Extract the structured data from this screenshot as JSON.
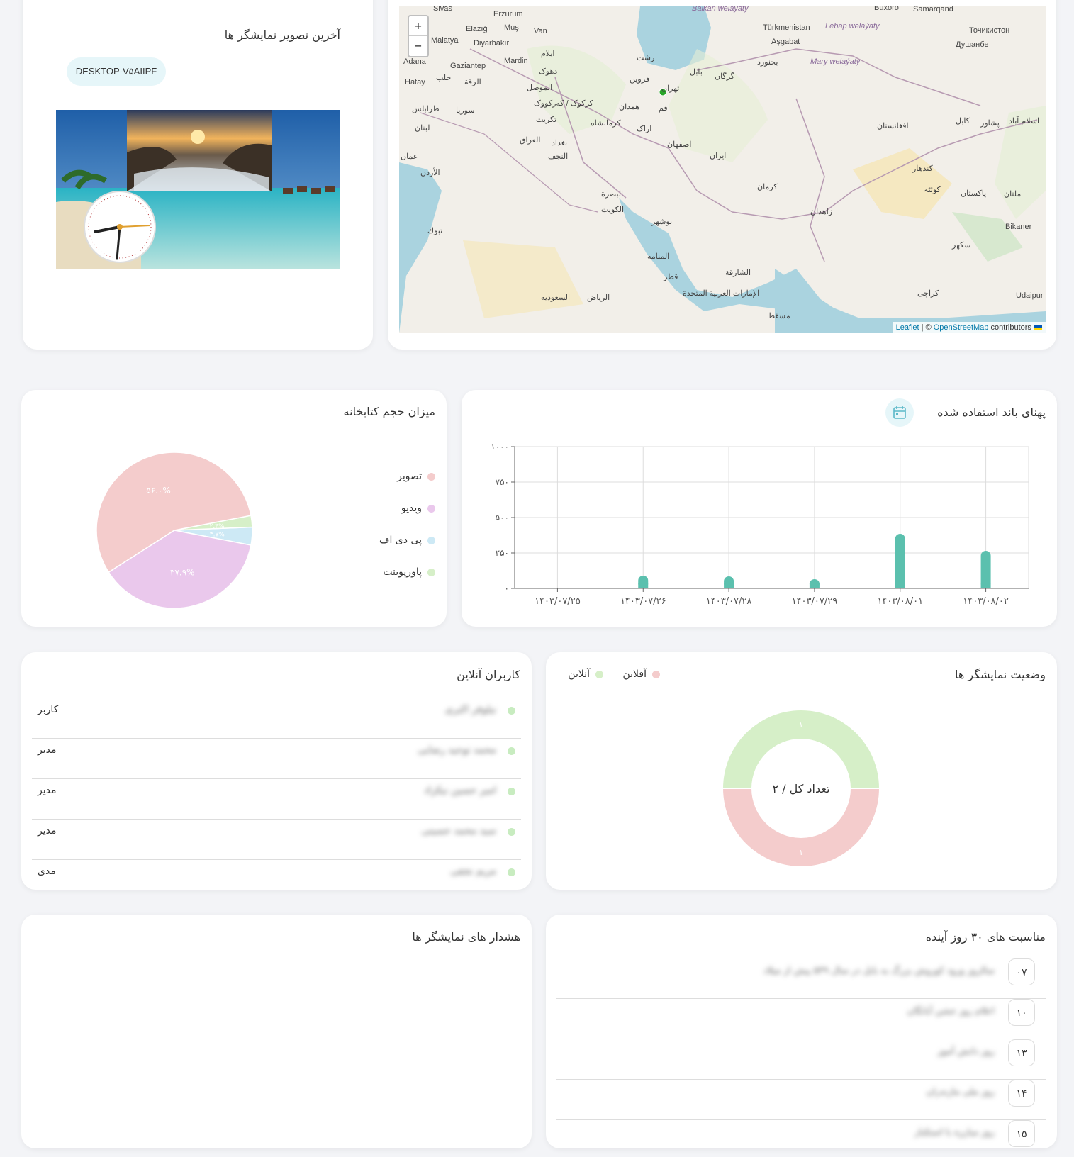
{
  "preview": {
    "title": "آخرین تصویر نمایشگر ها",
    "device_name": "DESKTOP-V۵AIIPF"
  },
  "map": {
    "zoom_in": "+",
    "zoom_out": "−",
    "attribution_leaflet": "Leaflet",
    "attribution_sep": " | © ",
    "attribution_osm": "OpenStreetMap",
    "attribution_tail": " contributors",
    "labels": [
      "Sivas",
      "Erzurum",
      "Elazığ",
      "Muş",
      "Van",
      "Malatya",
      "Diyarbakır",
      "Adana",
      "Gaziantep",
      "Mardin",
      "Hatay",
      "حلب",
      "الرقة",
      "دهوک",
      "الموصل",
      "کرکوک / که‌رکووک",
      "تکریت",
      "العراق",
      "بغداد",
      "النجف",
      "کرمانشاه",
      "همدان",
      "قزوین",
      "رشت",
      "بابل",
      "گرگان",
      "تهران",
      "قم",
      "اراک",
      "اصفهان",
      "ایران",
      "کرمان",
      "زاهدان",
      "بوشهر",
      "البصرة",
      "الکویت",
      "قطر",
      "المنامة",
      "الرياض",
      "السعودية",
      "مسقط",
      "الإمارات العربية المتحدة",
      "الشارقة",
      "بجنورد",
      "Aşgabat",
      "Türkmenistan",
      "Buxoro",
      "Samarqand",
      "Точикистон",
      "Душанбе",
      "افغانستان",
      "کندهار",
      "کوئٹہ",
      "پاکستان",
      "ملتان",
      "سکهر",
      "کراچی",
      "Bikaner",
      "Udaipur",
      "عمان",
      "لبنان",
      "سوريا",
      "تبوك",
      "طرابلس",
      "الأردن",
      "ايلام",
      "کابل",
      "اسلام آباد",
      "پشاور",
      "Balkan welaýaty",
      "Lebap welaýaty",
      "Mary welaýaty"
    ]
  },
  "library": {
    "title": "میزان حجم کتابخانه",
    "legend": [
      {
        "label": "تصویر",
        "color": "#f4cccc"
      },
      {
        "label": "ویدیو",
        "color": "#eac8ec"
      },
      {
        "label": "پی دی اف",
        "color": "#cde9f5"
      },
      {
        "label": "پاورپوینت",
        "color": "#d6efc8"
      }
    ],
    "slice_labels": [
      "۵۶.۰%",
      "۳۷.۹%",
      "۳.۷%",
      "۲.۴%"
    ]
  },
  "chart_data": {
    "type": "bar",
    "title": "پهنای باند استفاده شده",
    "categories": [
      "۱۴۰۳/۰۷/۲۵",
      "۱۴۰۳/۰۷/۲۶",
      "۱۴۰۳/۰۷/۲۸",
      "۱۴۰۳/۰۷/۲۹",
      "۱۴۰۳/۰۸/۰۱",
      "۱۴۰۳/۰۸/۰۲"
    ],
    "values": [
      0,
      90,
      85,
      65,
      385,
      265
    ],
    "ylim": [
      0,
      1000
    ],
    "yticks": [
      "۰",
      "۲۵۰",
      "۵۰۰",
      "۷۵۰",
      "۱۰۰۰"
    ],
    "grid": true,
    "color": "#5bc0ae",
    "pie": {
      "type": "pie",
      "categories": [
        "تصویر",
        "ویدیو",
        "پی دی اف",
        "پاورپوینت"
      ],
      "values": [
        56.0,
        37.9,
        3.7,
        2.4
      ],
      "colors": [
        "#f4cccc",
        "#eac8ec",
        "#cde9f5",
        "#d6efc8"
      ]
    },
    "donut": {
      "type": "pie",
      "categories": [
        "آنلاین",
        "آفلاین"
      ],
      "values": [
        1,
        1
      ],
      "colors": [
        "#d6efc8",
        "#f4cccc"
      ]
    }
  },
  "users": {
    "title": "کاربران آنلاین",
    "rows": [
      {
        "name": "نیلوفر اکبری",
        "role": "کاربر"
      },
      {
        "name": "محمد توحید رضایی",
        "role": "مدیر"
      },
      {
        "name": "امیر حسین نیکزاد",
        "role": "مدیر"
      },
      {
        "name": "سید محمد حسینی",
        "role": "مدیر"
      },
      {
        "name": "مریم نجفی",
        "role": "مدی"
      }
    ]
  },
  "status": {
    "title": "وضعیت نمایشگر ها",
    "legend_online": "آنلاین",
    "legend_offline": "آفلاین",
    "center_text": "تعداد کل / ۲",
    "online_count": "۱",
    "offline_count": "۱"
  },
  "alerts": {
    "title": "هشدار های نمایشگر ها"
  },
  "events": {
    "title": "مناسبت های ۳۰ روز آینده",
    "rows": [
      {
        "day": "۰۷",
        "text": "سالروز ورود کوروش بزرگ به بابل در سال ۵۳۹ پیش از میلاد"
      },
      {
        "day": "۱۰",
        "text": "اعلام روز جشن آبانگان"
      },
      {
        "day": "۱۳",
        "text": "روز دانش آموز"
      },
      {
        "day": "۱۴",
        "text": "روز ملی مازندران"
      },
      {
        "day": "۱۵",
        "text": "روز مبارزه با استکبار"
      }
    ]
  }
}
